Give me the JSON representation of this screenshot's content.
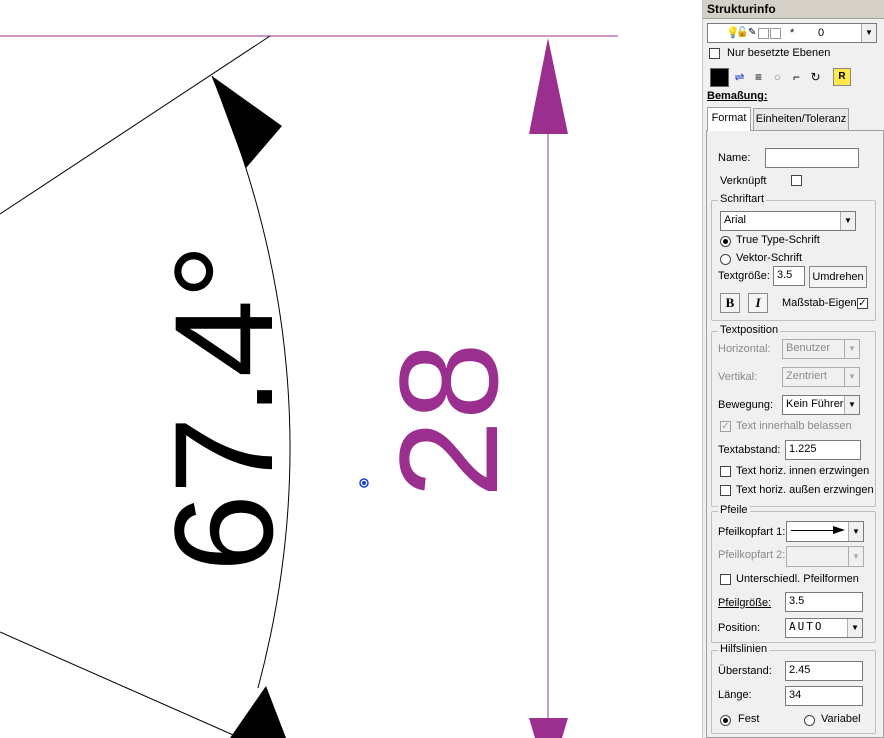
{
  "drawing": {
    "angle_text": "67.4°",
    "dim_text": "28",
    "colors": {
      "dimension": "#9b2f8f",
      "angle": "#000000",
      "center_point": "#1a3ccf"
    }
  },
  "panel": {
    "title": "Strukturinfo",
    "layer_select": {
      "symbols": "*",
      "value": "0"
    },
    "only_used_layers_label": "Nur besetzte Ebenen",
    "toolbar_icons": [
      "color-swatch-icon",
      "line-style-icon",
      "line-width-icon",
      "circle-icon",
      "layer-icon",
      "rotate-icon",
      "label-icon"
    ],
    "section_title": "Bemaßung:",
    "tabs": [
      "Format",
      "Einheiten/Toleranz"
    ],
    "name_label": "Name:",
    "name_value": "",
    "linked_label": "Verknüpft",
    "font_group": {
      "title": "Schriftart",
      "font_value": "Arial",
      "truetype_label": "True Type-Schrift",
      "vector_label": "Vektor-Schrift",
      "size_label": "Textgröße:",
      "size_value": "3.5",
      "flip_button": "Umdrehen",
      "bold_label": "B",
      "italic_label": "I",
      "scale_label": "Maßstab-Eigen"
    },
    "textpos_group": {
      "title": "Textposition",
      "horizontal_label": "Horizontal:",
      "horizontal_value": "Benutzer",
      "vertical_label": "Vertikal:",
      "vertical_value": "Zentriert",
      "movement_label": "Bewegung:",
      "movement_value": "Kein Führer",
      "keep_inside_label": "Text innerhalb belassen",
      "distance_label": "Textabstand:",
      "distance_value": "1.225",
      "force_inside_label": "Text horiz. innen erzwingen",
      "force_outside_label": "Text horiz. außen erzwingen"
    },
    "arrows_group": {
      "title": "Pfeile",
      "head1_label": "Pfeilkopfart 1:",
      "head2_label": "Pfeilkopfart 2:",
      "different_label": "Unterschiedl. Pfeilformen",
      "size_label": "Pfeilgröße:",
      "size_value": "3.5",
      "position_label": "Position:",
      "position_value": "AUTO"
    },
    "aux_group": {
      "title": "Hilfslinien",
      "overhang_label": "Überstand:",
      "overhang_value": "2.45",
      "length_label": "Länge:",
      "length_value": "34",
      "fixed_label": "Fest",
      "variable_label": "Variabel"
    }
  }
}
